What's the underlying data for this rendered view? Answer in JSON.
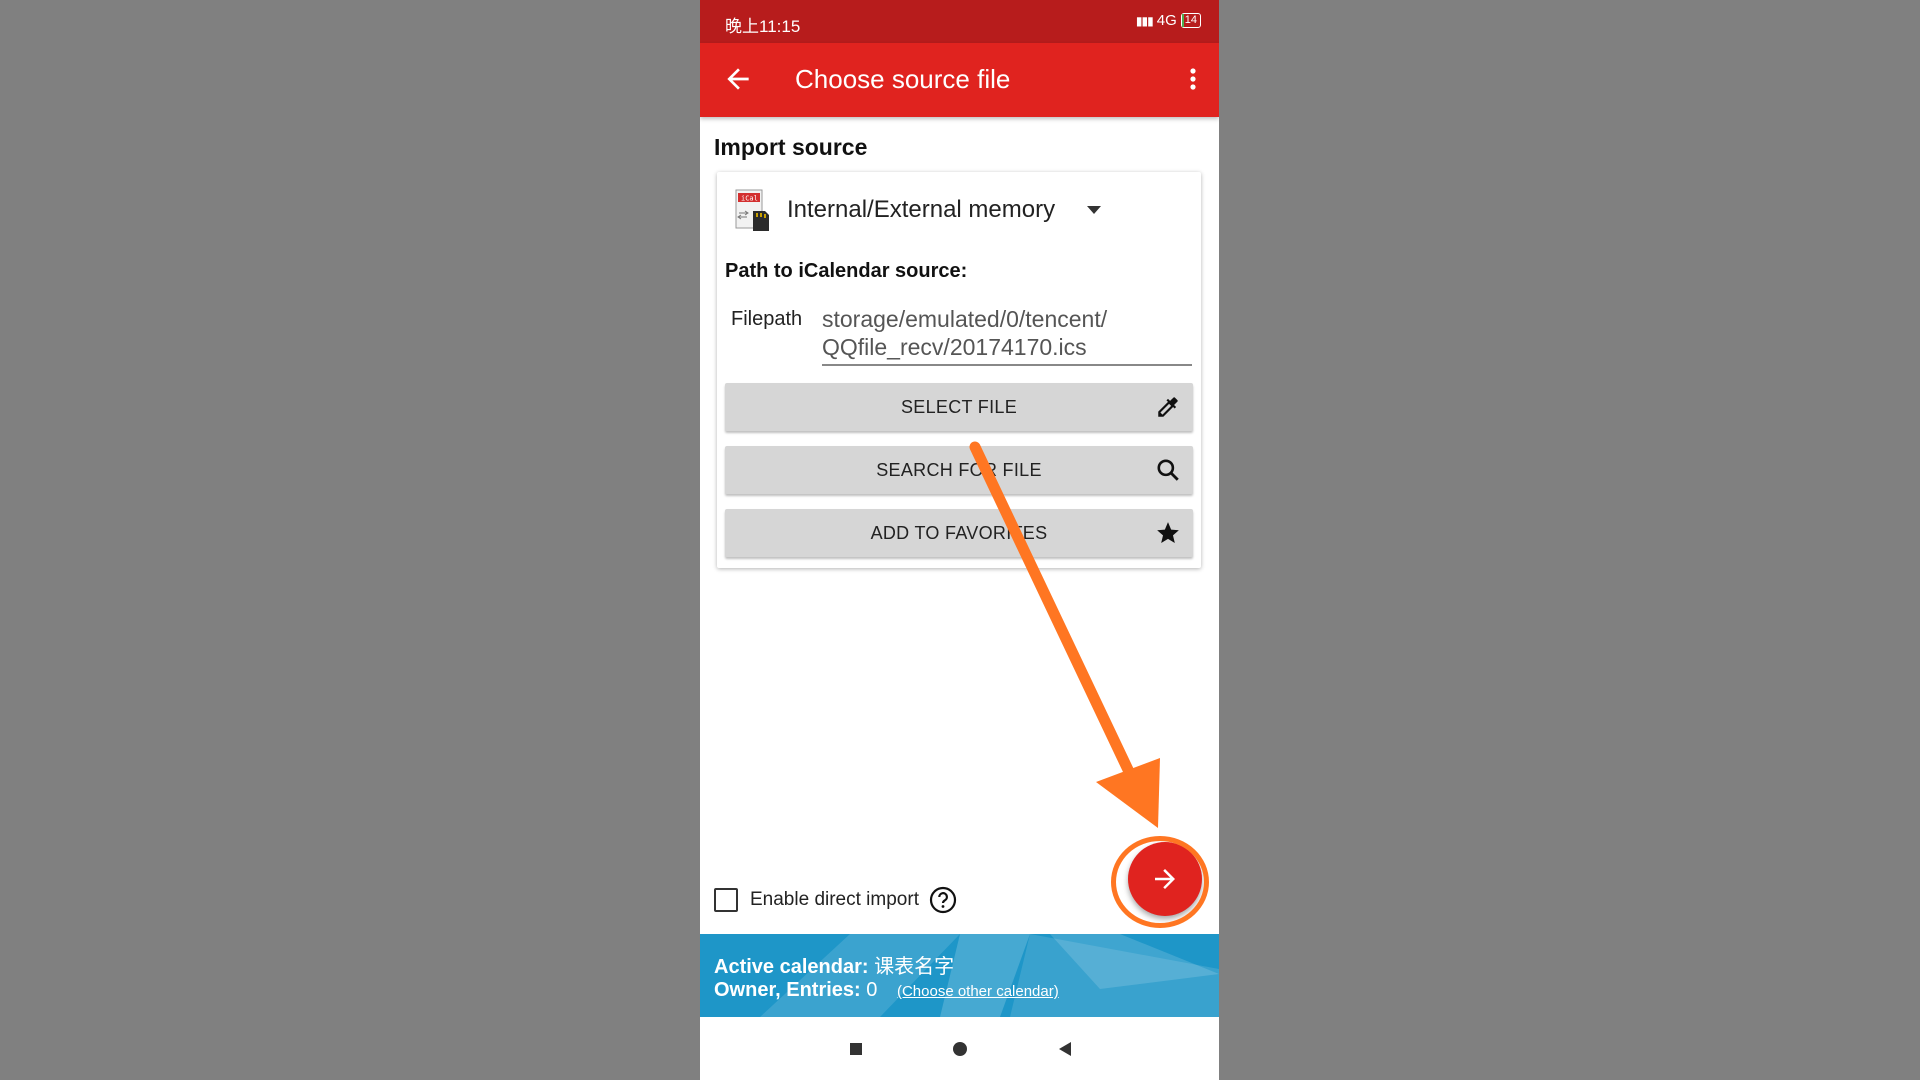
{
  "status_bar": {
    "time": "晚上11:15",
    "signal": "4G",
    "battery": "14"
  },
  "app_bar": {
    "title": "Choose source file",
    "back_icon": "arrow-left-icon",
    "menu_icon": "more-vert-icon"
  },
  "import_section": {
    "label": "Import source",
    "source_icon": "ical-sdcard-icon",
    "source_value": "Internal/External memory",
    "path_label": "Path to iCalendar source:",
    "filepath_label": "Filepath",
    "filepath_value": "storage/emulated/0/tencent/\nQQfile_recv/20174170.ics"
  },
  "buttons": [
    {
      "label": "SELECT FILE",
      "icon": "eyedropper-icon"
    },
    {
      "label": "SEARCH FOR FILE",
      "icon": "search-icon"
    },
    {
      "label": "ADD TO FAVORITES",
      "icon": "star-icon"
    }
  ],
  "direct_import": {
    "label": "Enable direct import",
    "checked": false,
    "help_icon": "help-circle-icon"
  },
  "fab": {
    "icon": "arrow-right-icon"
  },
  "calendar_banner": {
    "active_label": "Active calendar:",
    "active_value": "课表名字",
    "owner_label": "Owner, Entries:",
    "entries_value": "0",
    "link": "(Choose other calendar)"
  },
  "nav_bar": {
    "icons": [
      "recent-apps-icon",
      "home-icon",
      "back-triangle-icon"
    ]
  },
  "colors": {
    "status_bar": "#b71c1c",
    "app_bar": "#e0231f",
    "banner": "#1e96c8",
    "annotation_arrow": "#ff7622",
    "background": "#808080"
  }
}
